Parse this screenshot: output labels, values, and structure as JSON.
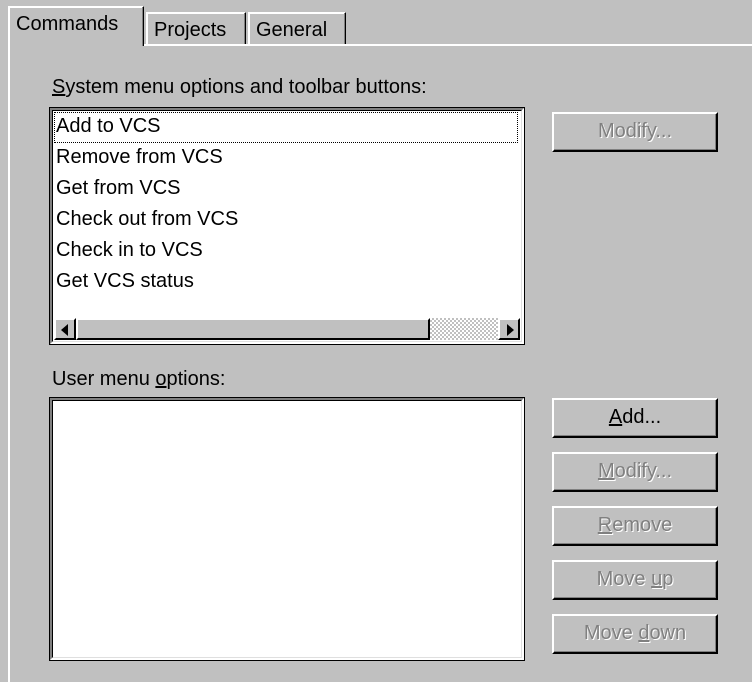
{
  "tabs": [
    {
      "label": "Commands",
      "active": true
    },
    {
      "label": "Projects",
      "active": false
    },
    {
      "label": "General",
      "active": false
    }
  ],
  "system_section": {
    "label_mnemonic": "S",
    "label_rest": "ystem menu options and toolbar buttons:",
    "items": [
      "Add to VCS",
      "Remove from VCS",
      "Get from VCS",
      "Check out from VCS",
      "Check in to VCS",
      "Get VCS status"
    ],
    "modify_button": {
      "label": "Modify...",
      "enabled": false
    }
  },
  "user_section": {
    "label_pre": "User menu ",
    "label_mnemonic": "o",
    "label_post": "ptions:",
    "items": [],
    "buttons": {
      "add": {
        "mnemonic": "A",
        "rest": "dd...",
        "enabled": true
      },
      "modify": {
        "mnemonic": "M",
        "rest": "odify...",
        "enabled": false
      },
      "remove": {
        "mnemonic": "R",
        "rest": "emove",
        "enabled": false
      },
      "move_up": {
        "pre": "Move ",
        "mnemonic": "u",
        "post": "p",
        "enabled": false
      },
      "move_down": {
        "pre": "Move ",
        "mnemonic": "d",
        "post": "own",
        "enabled": false
      }
    }
  }
}
